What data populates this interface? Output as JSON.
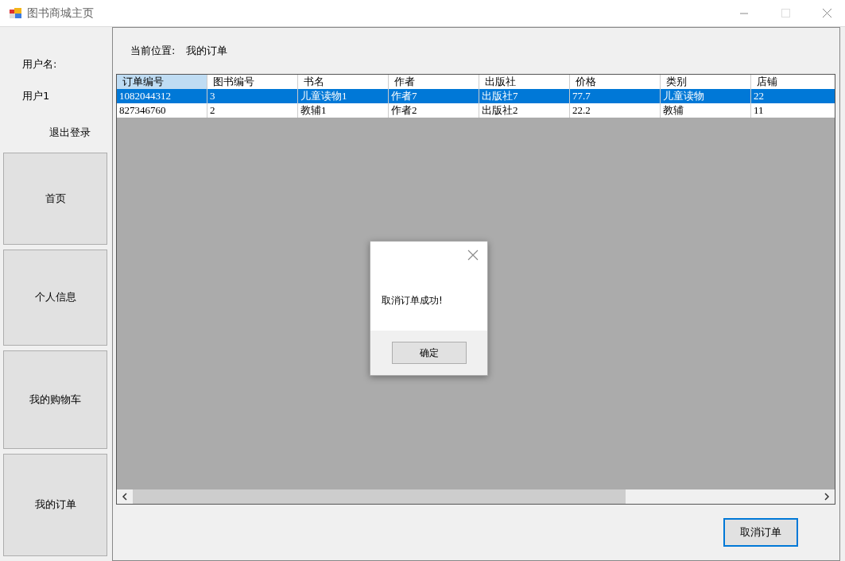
{
  "window": {
    "title": "图书商城主页"
  },
  "user_panel": {
    "label": "用户名:",
    "username": "用户1",
    "logout": "退出登录"
  },
  "nav": [
    {
      "label": "首页"
    },
    {
      "label": "个人信息"
    },
    {
      "label": "我的购物车"
    },
    {
      "label": "我的订单"
    }
  ],
  "location": {
    "label": "当前位置:",
    "value": "我的订单"
  },
  "table": {
    "columns": [
      "订单编号",
      "图书编号",
      "书名",
      "作者",
      "出版社",
      "价格",
      "类别",
      "店铺"
    ],
    "rows": [
      {
        "cells": [
          "1082044312",
          "3",
          "儿童读物1",
          "作者7",
          "出版社7",
          "77.7",
          "儿童读物",
          "22"
        ],
        "selected": true
      },
      {
        "cells": [
          "827346760",
          "2",
          "教辅1",
          "作者2",
          "出版社2",
          "22.2",
          "教辅",
          "11"
        ],
        "selected": false
      }
    ]
  },
  "dialog": {
    "message": "取消订单成功!",
    "ok": "确定"
  },
  "cancel_button": "取消订单"
}
